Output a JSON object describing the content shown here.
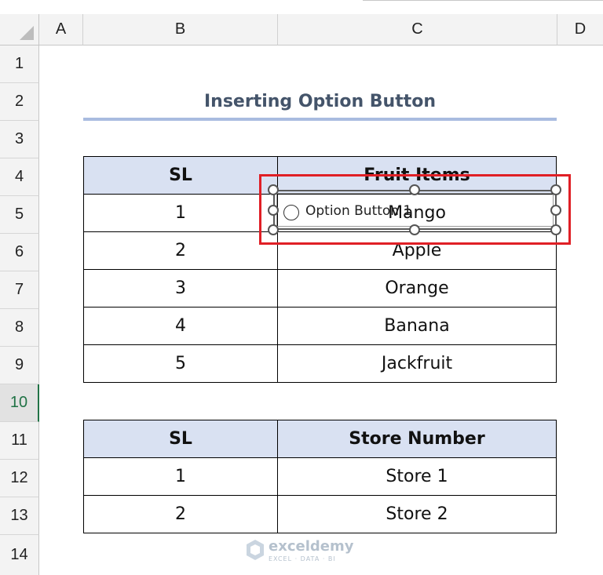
{
  "columns": [
    "A",
    "B",
    "C",
    "D"
  ],
  "rows": [
    "1",
    "2",
    "3",
    "4",
    "5",
    "6",
    "7",
    "8",
    "9",
    "10",
    "11",
    "12",
    "13",
    "14"
  ],
  "active_row": "10",
  "title": "Inserting Option Button",
  "fruit_table": {
    "headers": [
      "SL",
      "Fruit Items"
    ],
    "rows": [
      [
        "1",
        "Mango"
      ],
      [
        "2",
        "Apple"
      ],
      [
        "3",
        "Orange"
      ],
      [
        "4",
        "Banana"
      ],
      [
        "5",
        "Jackfruit"
      ]
    ]
  },
  "store_table": {
    "headers": [
      "SL",
      "Store Number"
    ],
    "rows": [
      [
        "1",
        "Store 1"
      ],
      [
        "2",
        "Store 2"
      ]
    ]
  },
  "option_button": {
    "label": "Option Button 1"
  },
  "watermark": {
    "name": "exceldemy",
    "tagline": "EXCEL · DATA · BI"
  },
  "colors": {
    "header_fill": "#d9e1f2",
    "selection": "#e01f26",
    "title": "#44546a",
    "active_row": "#217346"
  }
}
